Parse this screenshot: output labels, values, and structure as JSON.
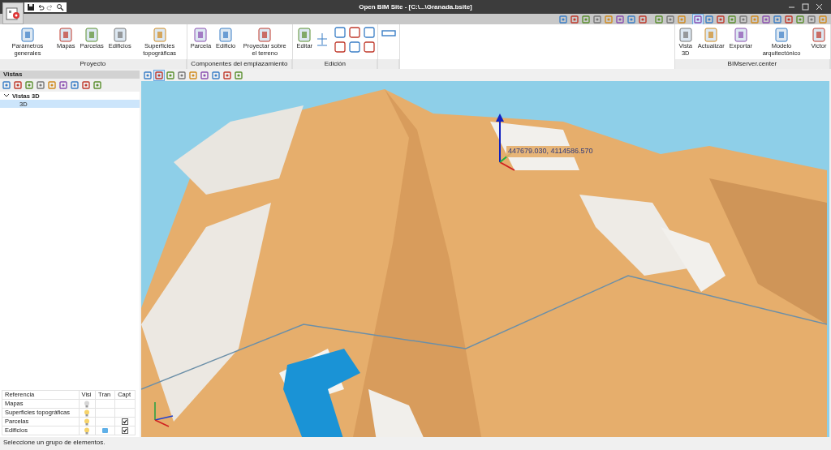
{
  "window": {
    "title": "Open BIM Site - [C:\\...\\Granada.bsite]"
  },
  "display_tools": [
    {
      "selected": false
    },
    {
      "selected": false
    },
    {
      "selected": false
    },
    {
      "selected": false
    },
    {
      "selected": false
    },
    {
      "selected": false
    },
    {
      "selected": false
    },
    {
      "selected": false
    },
    {
      "selected": false
    },
    {
      "selected": false
    },
    {
      "selected": false
    },
    {
      "selected": true
    },
    {
      "selected": false
    },
    {
      "selected": false
    },
    {
      "selected": false
    },
    {
      "selected": false
    },
    {
      "selected": false
    },
    {
      "selected": false
    },
    {
      "selected": false
    },
    {
      "selected": false
    },
    {
      "selected": false
    },
    {
      "selected": false
    },
    {
      "selected": false
    }
  ],
  "ribbon": [
    {
      "label": "Proyecto",
      "buttons": [
        {
          "label": "Parámetros generales"
        },
        {
          "label": "Mapas"
        },
        {
          "label": "Parcelas"
        },
        {
          "label": "Edificios"
        },
        {
          "label": "Superficies topográficas"
        }
      ]
    },
    {
      "label": "Componentes del emplazamiento",
      "buttons": [
        {
          "label": "Parcela"
        },
        {
          "label": "Edificio"
        },
        {
          "label": "Proyectar sobre el terreno"
        }
      ]
    },
    {
      "label": "Edición",
      "buttons": [
        {
          "label": "Editar"
        }
      ]
    },
    {
      "label": "BIMserver.center",
      "buttons": [
        {
          "label": "Vista 3D"
        },
        {
          "label": "Actualizar"
        },
        {
          "label": "Exportar"
        },
        {
          "label": "Modelo arquitectónico"
        },
        {
          "label": "Victor"
        }
      ]
    }
  ],
  "left_panel": {
    "title": "Vistas",
    "tree": [
      {
        "label": "Vistas 3D",
        "expanded": true,
        "selected": false,
        "children": [
          {
            "label": "3D",
            "selected": true
          }
        ]
      }
    ]
  },
  "view_tools": [
    {
      "selected": false
    },
    {
      "selected": true
    },
    {
      "selected": false
    },
    {
      "selected": false
    },
    {
      "selected": false
    },
    {
      "selected": false
    },
    {
      "selected": false
    },
    {
      "selected": false
    },
    {
      "selected": false
    }
  ],
  "layers_table": {
    "columns": [
      "Referencia",
      "Visi",
      "Tran",
      "Capt"
    ],
    "rows": [
      {
        "name": "Mapas",
        "visible": false,
        "transparent": false,
        "capture": false
      },
      {
        "name": "Superficies topográficas",
        "visible": true,
        "transparent": false,
        "capture": false
      },
      {
        "name": "Parcelas",
        "visible": true,
        "transparent": false,
        "capture": true
      },
      {
        "name": "Edificios",
        "visible": true,
        "transparent": true,
        "capture": true
      }
    ]
  },
  "viewport": {
    "kind": "picture",
    "coordinate_label": "447679.030, 4114586.570"
  },
  "status_bar": "Seleccione un grupo de elementos."
}
